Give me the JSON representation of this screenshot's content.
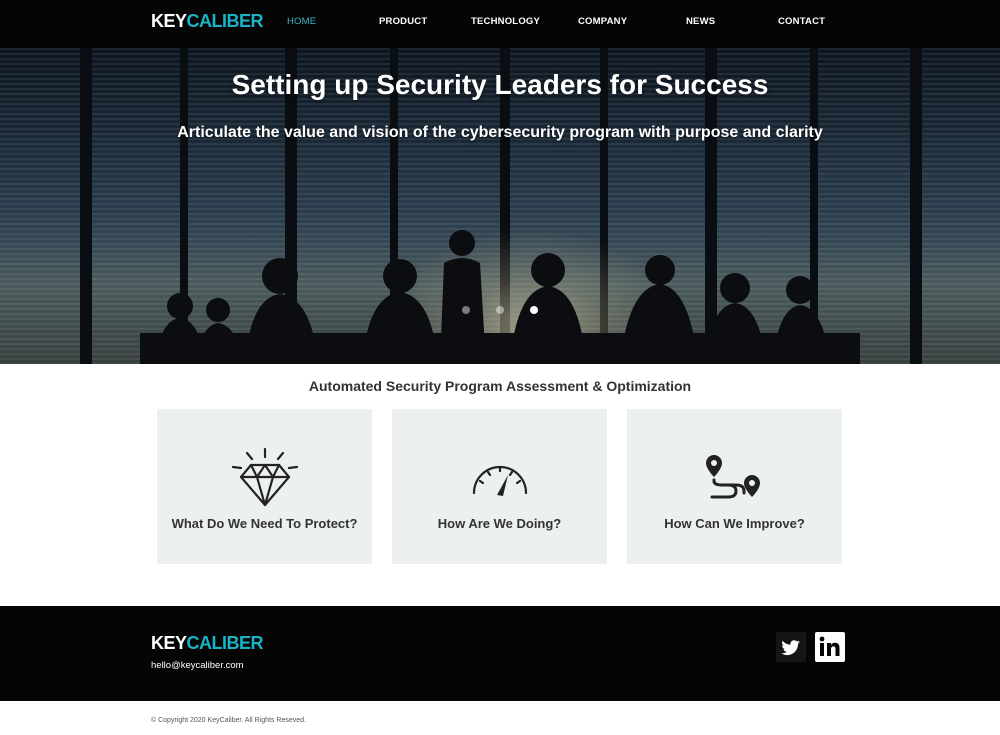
{
  "brand": {
    "logo_part_a": "KEY",
    "logo_part_b": "CALIBER",
    "accent_color": "#19b3c6"
  },
  "nav": {
    "items": [
      {
        "label": "HOME",
        "active": true
      },
      {
        "label": "PRODUCT"
      },
      {
        "label": "TECHNOLOGY"
      },
      {
        "label": "COMPANY"
      },
      {
        "label": "NEWS"
      },
      {
        "label": "CONTACT"
      }
    ]
  },
  "hero": {
    "title": "Setting up Security Leaders for Success",
    "subtitle": "Articulate the value and vision of the cybersecurity program with purpose and clarity",
    "slides": 3,
    "active_slide": 3
  },
  "section": {
    "heading": "Automated Security Program Assessment & Optimization",
    "cards": [
      {
        "label": "What Do We Need To Protect?",
        "icon": "diamond-icon"
      },
      {
        "label": "How Are We Doing?",
        "icon": "speedometer-icon"
      },
      {
        "label": "How Can We Improve?",
        "icon": "route-icon"
      }
    ]
  },
  "footer": {
    "email": "hello@keycaliber.com",
    "social": [
      {
        "icon": "twitter-icon"
      },
      {
        "icon": "linkedin-icon"
      }
    ],
    "copyright": "© Copyright 2020 KeyCaliber. All Rights Reseved."
  }
}
